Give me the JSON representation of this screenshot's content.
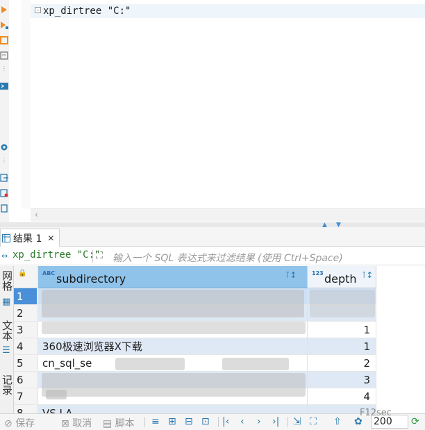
{
  "editor": {
    "code": "xp_dirtree \"C:\"",
    "fold_marker": "-"
  },
  "results_tab": {
    "label": "结果 1",
    "close": "✕"
  },
  "filter": {
    "query": "xp_dirtree \"C:\"",
    "placeholder": "输入一个 SQL 表达式来过滤结果 (使用 Ctrl+Space)"
  },
  "side_tabs": {
    "grid": "网格",
    "text": "文本",
    "records": "记录"
  },
  "grid": {
    "columns": [
      {
        "type_tag": "ABC",
        "name": "subdirectory"
      },
      {
        "type_tag": "123",
        "name": "depth"
      }
    ],
    "rows": [
      {
        "num": "1",
        "subdirectory": "",
        "depth": ""
      },
      {
        "num": "2",
        "subdirectory": "",
        "depth": ""
      },
      {
        "num": "3",
        "subdirectory": "",
        "depth": "1"
      },
      {
        "num": "4",
        "subdirectory": "360极速浏览器X下载",
        "depth": "1"
      },
      {
        "num": "5",
        "subdirectory": "cn_sql_se",
        "depth": "2"
      },
      {
        "num": "6",
        "subdirectory": "",
        "depth": "3"
      },
      {
        "num": "7",
        "subdirectory": "",
        "depth": "4"
      },
      {
        "num": "8",
        "subdirectory": "VS LA",
        "depth": ""
      }
    ]
  },
  "toolbar": {
    "save": "保存",
    "cancel": "取消",
    "script": "脚本",
    "fetch_size": "200"
  },
  "watermark": "F12sec"
}
